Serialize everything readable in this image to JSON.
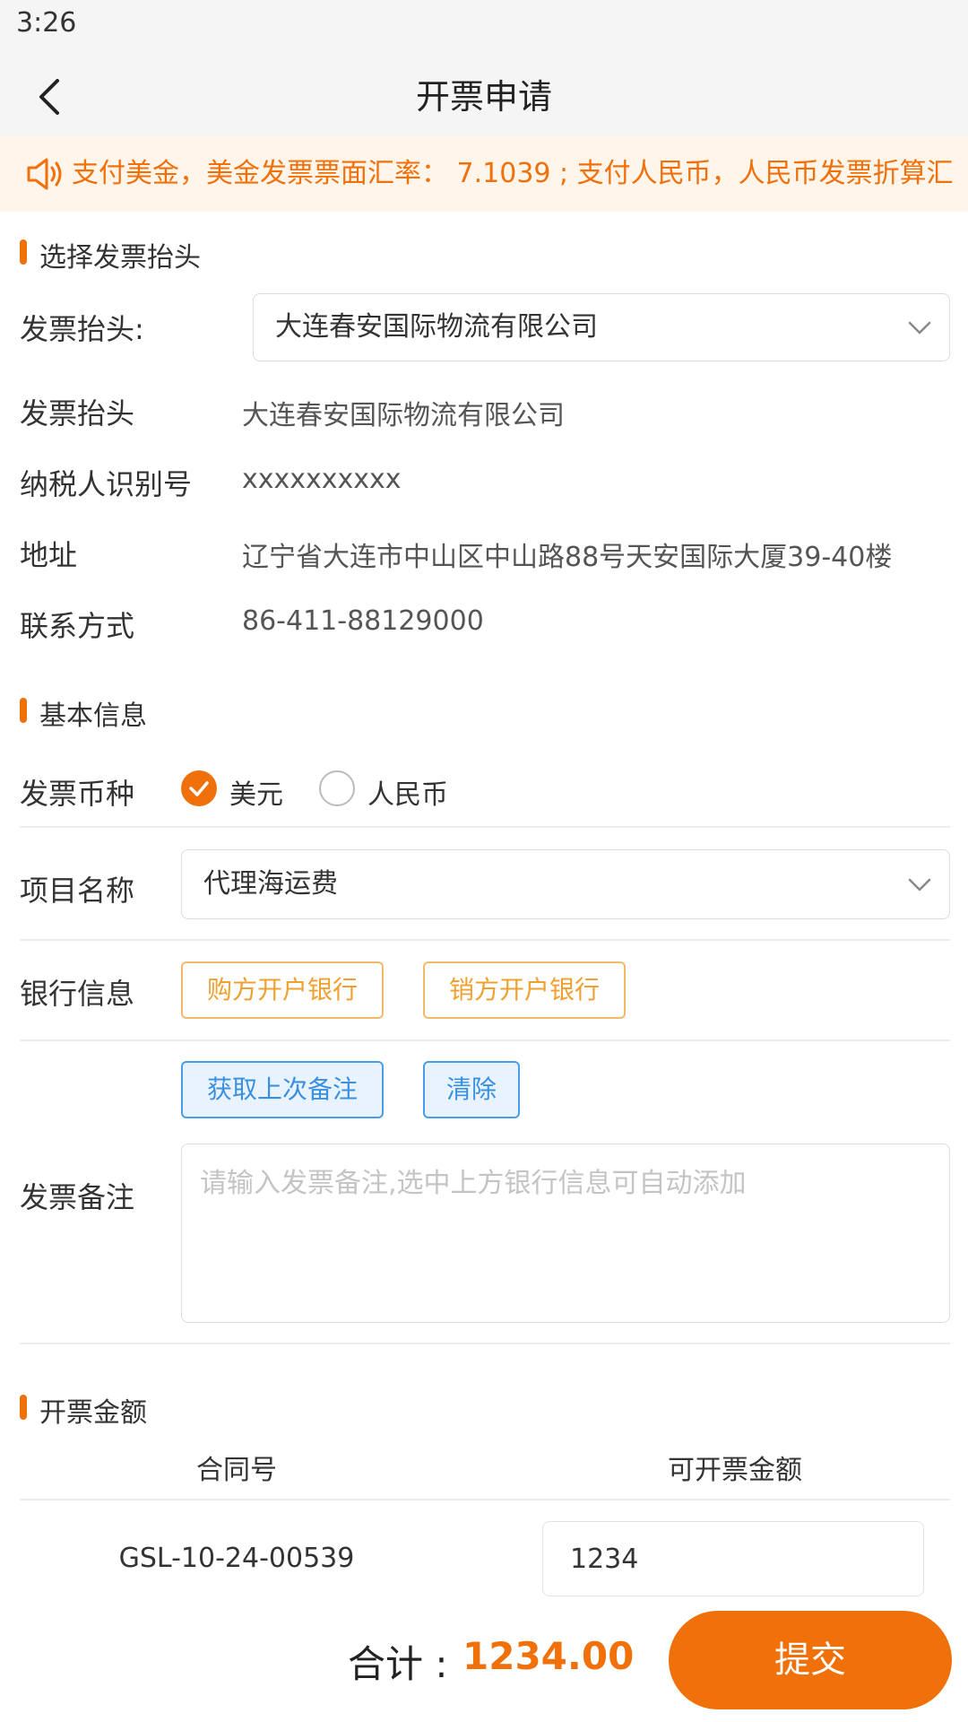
{
  "status": {
    "time": "3:26"
  },
  "nav": {
    "title": "开票申请"
  },
  "notice": {
    "text": "支付美金，美金发票票面汇率： 7.1039 ; 支付人民币，人民币发票折算汇",
    "accent": "#f0700a"
  },
  "section_header": {
    "title": "选择发票抬头"
  },
  "invoice_header": {
    "select_label": "发票抬头:",
    "select_value": "大连春安国际物流有限公司",
    "rows": [
      {
        "label": "发票抬头",
        "value": "大连春安国际物流有限公司"
      },
      {
        "label": "纳税人识别号",
        "value": "xxxxxxxxxx"
      },
      {
        "label": "地址",
        "value": "辽宁省大连市中山区中山路88号天安国际大厦39-40楼"
      },
      {
        "label": "联系方式",
        "value": "86-411-88129000"
      }
    ]
  },
  "section_basic": {
    "title": "基本信息"
  },
  "currency": {
    "label": "发票币种",
    "options": [
      {
        "label": "美元",
        "selected": true
      },
      {
        "label": "人民币",
        "selected": false
      }
    ]
  },
  "project": {
    "label": "项目名称",
    "value": "代理海运费"
  },
  "bank": {
    "label": "银行信息",
    "buyer_button": "购方开户银行",
    "seller_button": "销方开户银行"
  },
  "remark": {
    "label": "发票备注",
    "get_last_button": "获取上次备注",
    "clear_button": "清除",
    "placeholder": "请输入发票备注,选中上方银行信息可自动添加"
  },
  "section_amount": {
    "title": "开票金额"
  },
  "amount_table": {
    "headers": [
      "合同号",
      "可开票金额"
    ],
    "rows": [
      {
        "contract": "GSL-10-24-00539",
        "amount": "1234"
      }
    ]
  },
  "footer": {
    "total_label": "合计 :",
    "total_value": "1234.00",
    "submit_label": "提交"
  }
}
